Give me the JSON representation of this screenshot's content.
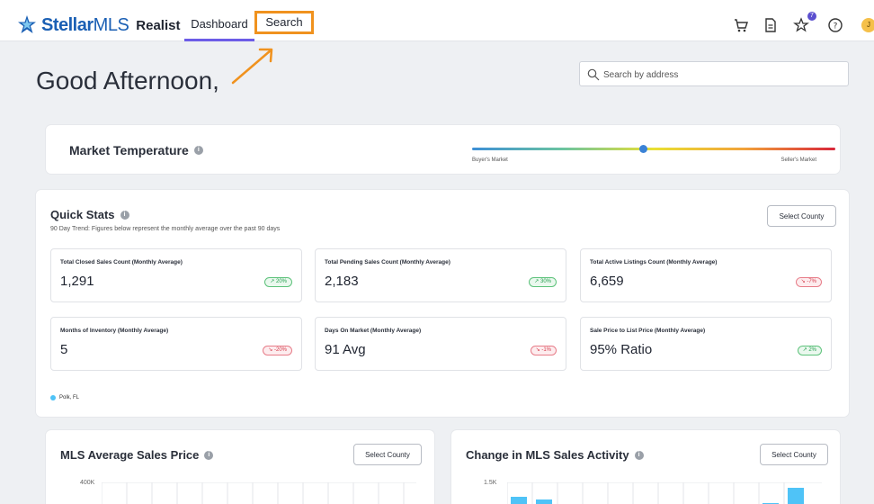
{
  "header": {
    "brand_a": "Stellar",
    "brand_b": "MLS",
    "product": "Realist",
    "nav": {
      "dashboard": "Dashboard",
      "search": "Search"
    },
    "favorites_count": "7",
    "avatar_initial": "J"
  },
  "greeting": "Good Afternoon,",
  "search": {
    "placeholder": "Search by address"
  },
  "market_temperature": {
    "title": "Market Temperature",
    "buyer_label": "Buyer's Market",
    "seller_label": "Seller's Market",
    "level": 0.47
  },
  "quick_stats": {
    "title": "Quick Stats",
    "subtitle": "90 Day Trend: Figures below represent the monthly average over the past 90 days",
    "select_county": "Select County",
    "legend": "Polk, FL",
    "stats": [
      {
        "label": "Total Closed Sales Count (Monthly Average)",
        "value": "1,291",
        "trend": "20%",
        "direction": "up"
      },
      {
        "label": "Total Pending Sales Count (Monthly Average)",
        "value": "2,183",
        "trend": "30%",
        "direction": "up"
      },
      {
        "label": "Total Active Listings Count (Monthly Average)",
        "value": "6,659",
        "trend": "-7%",
        "direction": "down"
      },
      {
        "label": "Months of Inventory (Monthly Average)",
        "value": "5",
        "trend": "-20%",
        "direction": "down"
      },
      {
        "label": "Days On Market (Monthly Average)",
        "value": "91 Avg",
        "trend": "-1%",
        "direction": "down"
      },
      {
        "label": "Sale Price to List Price (Monthly Average)",
        "value": "95% Ratio",
        "trend": "2%",
        "direction": "up"
      }
    ]
  },
  "avg_sales_price": {
    "title": "MLS Average Sales Price",
    "select_county": "Select County",
    "y_top": "400K"
  },
  "sales_activity": {
    "title": "Change in MLS Sales Activity",
    "select_county": "Select County",
    "y_top": "1.5K"
  },
  "colors": {
    "accent": "#6c5ce7",
    "highlight": "#f0921e",
    "brand": "#1a5fb4",
    "bar": "#4fc3f7"
  }
}
